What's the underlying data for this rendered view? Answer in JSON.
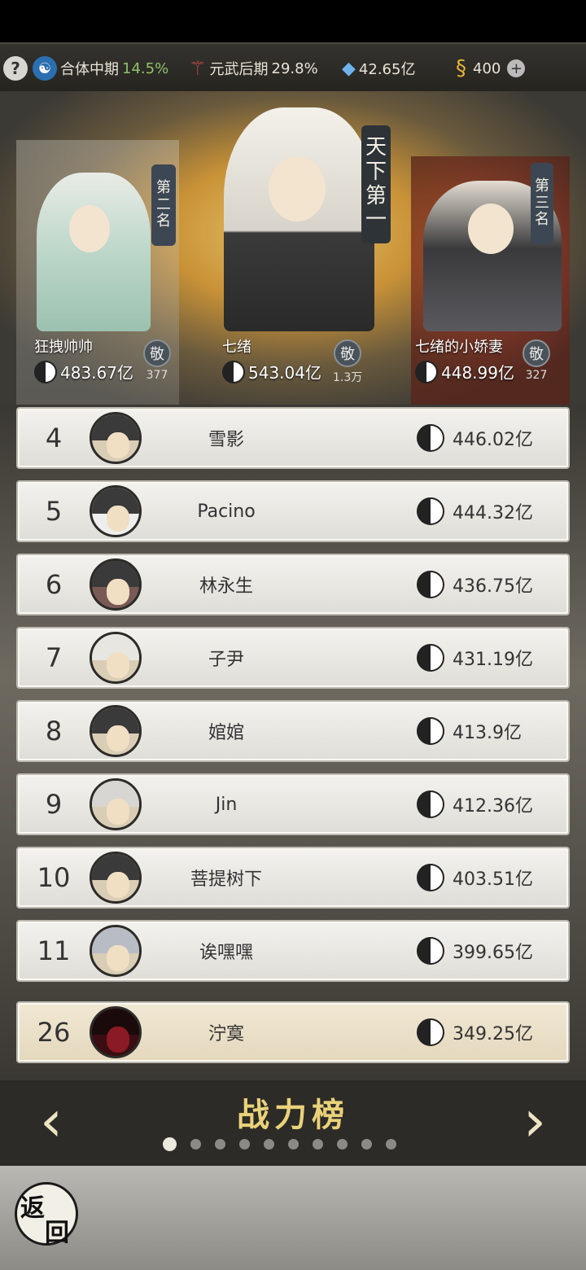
{
  "topbar": {
    "help_icon": "?",
    "cultivation": {
      "label": "合体中期",
      "pct": "14.5%"
    },
    "martial": {
      "label": "元武后期",
      "pct": "29.8%"
    },
    "gems": "42.65亿",
    "coins": "400"
  },
  "podium": {
    "first": {
      "banner": [
        "天",
        "下",
        "第",
        "一"
      ],
      "name": "七绪",
      "power": "543.04亿",
      "respect": "敬",
      "respect_count": "1.3万"
    },
    "second": {
      "banner": [
        "第",
        "二",
        "名"
      ],
      "name": "狂拽帅帅",
      "power": "483.67亿",
      "respect": "敬",
      "respect_count": "377"
    },
    "third": {
      "banner": [
        "第",
        "三",
        "名"
      ],
      "name": "七绪的小娇妻",
      "power": "448.99亿",
      "respect": "敬",
      "respect_count": "327"
    }
  },
  "ranking": [
    {
      "rank": "4",
      "name": "雪影",
      "power": "446.02亿"
    },
    {
      "rank": "5",
      "name": "Pacino",
      "power": "444.32亿"
    },
    {
      "rank": "6",
      "name": "林永生",
      "power": "436.75亿"
    },
    {
      "rank": "7",
      "name": "子尹",
      "power": "431.19亿"
    },
    {
      "rank": "8",
      "name": "婠婠",
      "power": "413.9亿"
    },
    {
      "rank": "9",
      "name": "Jin",
      "power": "412.36亿"
    },
    {
      "rank": "10",
      "name": "菩提树下",
      "power": "403.51亿"
    },
    {
      "rank": "11",
      "name": "诶嘿嘿",
      "power": "399.65亿"
    }
  ],
  "my_rank": {
    "rank": "26",
    "name": "泞寞",
    "power": "349.25亿"
  },
  "nav": {
    "title": "战力榜",
    "left_arrow": "‹",
    "right_arrow": "›",
    "page_count": 10,
    "active_page": 1
  },
  "back_button": {
    "char1": "返",
    "char2": "回"
  }
}
